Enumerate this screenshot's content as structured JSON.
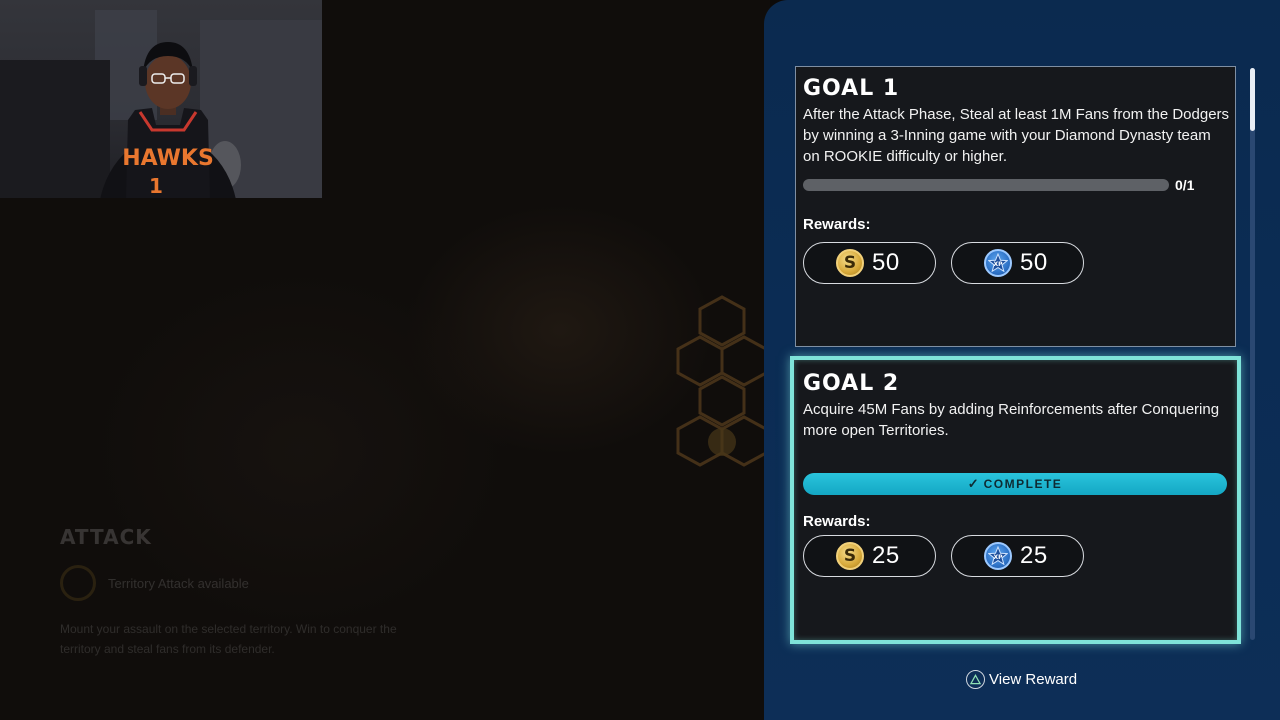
{
  "colors": {
    "panel_bg": "#0b2c54",
    "card_bg": "#16181c",
    "complete_accent": "#1fb7d2",
    "selected_border": "#7fe3d9",
    "coin_gold": "#d7a93a",
    "xp_blue": "#2b6fc4"
  },
  "webcam": {
    "jersey_text": "HAWKS",
    "jersey_number": "1"
  },
  "background_panel": {
    "title": "ATTACK",
    "subtitle": "Territory Attack available",
    "description": "Mount your assault on the selected territory. Win to conquer the territory and steal fans from its defender."
  },
  "goals": [
    {
      "title": "GOAL 1",
      "description": "After the Attack Phase, Steal at least 1M Fans from the Dodgers by winning a 3-Inning game with your Diamond Dynasty team on ROOKIE difficulty or higher.",
      "progress_text": "0/1",
      "progress_fraction": 0,
      "rewards_label": "Rewards:",
      "rewards": [
        {
          "icon": "stubs-coin-icon",
          "glyph": "S",
          "value": "50"
        },
        {
          "icon": "xp-star-icon",
          "value": "50"
        }
      ]
    },
    {
      "title": "GOAL 2",
      "description": "Acquire 45M Fans by adding Reinforcements after Conquering more open Territories.",
      "status": "COMPLETE",
      "status_icon": "✓",
      "rewards_label": "Rewards:",
      "rewards": [
        {
          "icon": "stubs-coin-icon",
          "glyph": "S",
          "value": "25"
        },
        {
          "icon": "xp-star-icon",
          "value": "25"
        }
      ]
    }
  ],
  "footer": {
    "action_icon": "triangle-button-icon",
    "action_label": "View Reward"
  }
}
